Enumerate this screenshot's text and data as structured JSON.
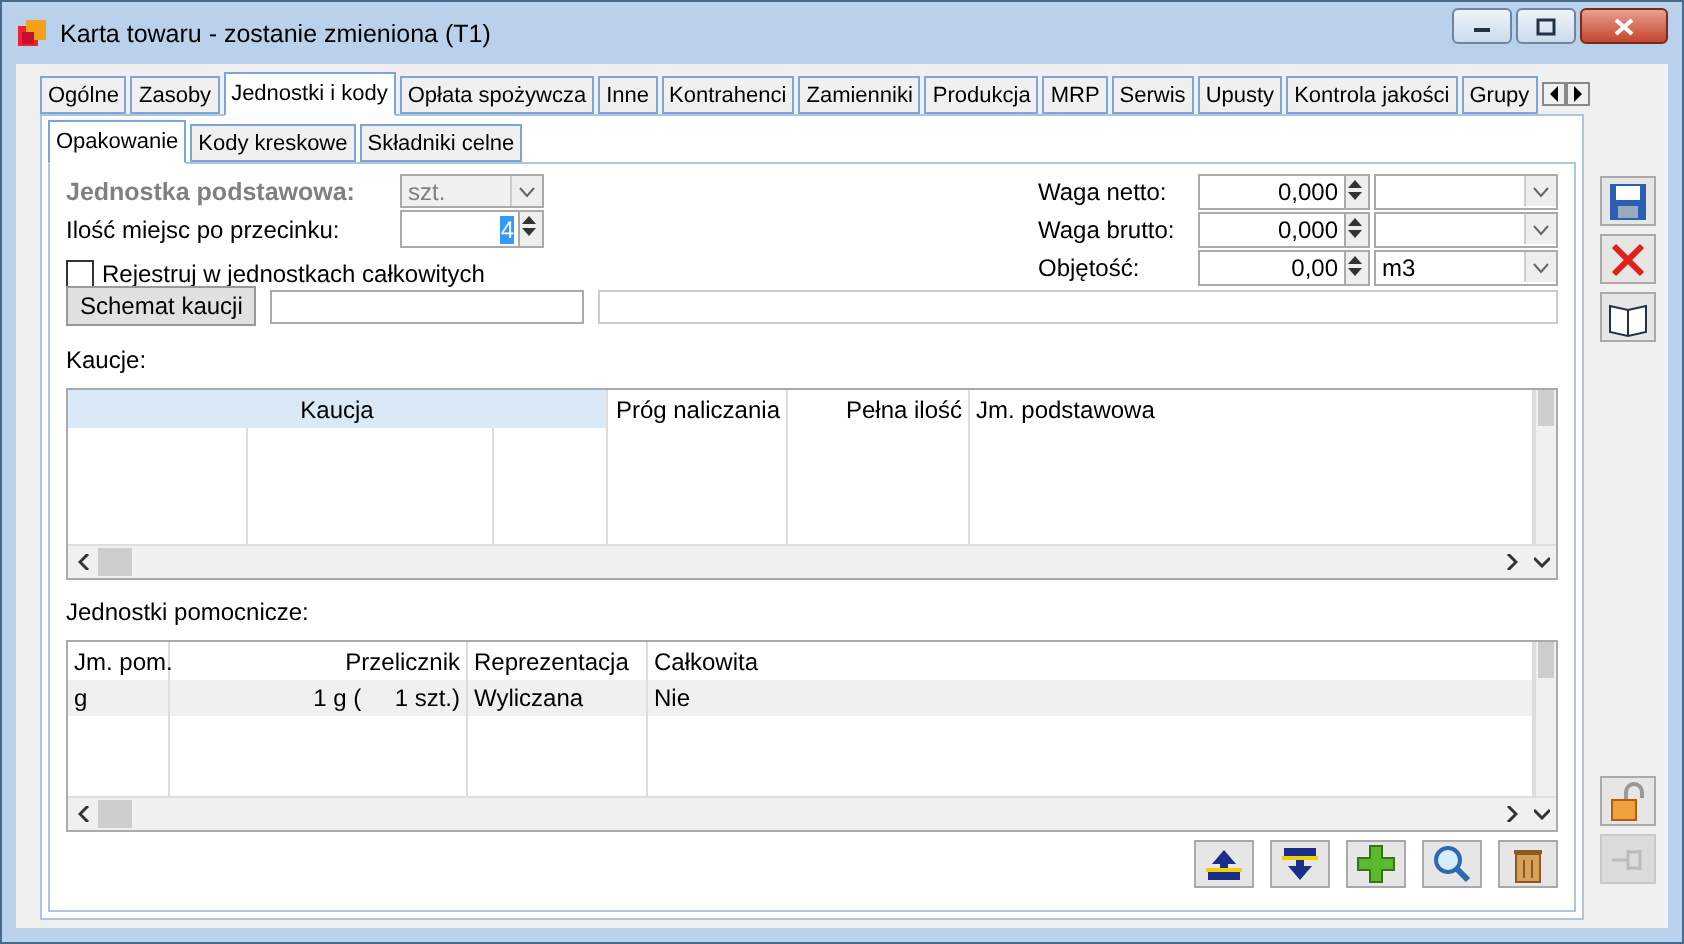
{
  "window": {
    "title": "Karta towaru - zostanie zmieniona (T1)"
  },
  "tabs": [
    {
      "label": "Ogólne",
      "selected": false
    },
    {
      "label": "Zasoby",
      "selected": false
    },
    {
      "label": "Jednostki i kody",
      "selected": true
    },
    {
      "label": "Opłata spożywcza",
      "selected": false
    },
    {
      "label": "Inne",
      "selected": false
    },
    {
      "label": "Kontrahenci",
      "selected": false
    },
    {
      "label": "Zamienniki",
      "selected": false
    },
    {
      "label": "Produkcja",
      "selected": false
    },
    {
      "label": "MRP",
      "selected": false
    },
    {
      "label": "Serwis",
      "selected": false
    },
    {
      "label": "Upusty",
      "selected": false
    },
    {
      "label": "Kontrola jakości",
      "selected": false
    },
    {
      "label": "Grupy",
      "selected": false
    }
  ],
  "subtabs": [
    {
      "label": "Opakowanie",
      "selected": true
    },
    {
      "label": "Kody kreskowe",
      "selected": false
    },
    {
      "label": "Składniki celne",
      "selected": false
    }
  ],
  "base_unit": {
    "label": "Jednostka podstawowa:",
    "value": "szt.",
    "disabled": true
  },
  "decimal_places": {
    "label": "Ilość miejsc po przecinku:",
    "value": "4"
  },
  "integer_units": {
    "label": "Rejestruj w jednostkach całkowitych",
    "checked": false
  },
  "deposit_scheme": {
    "button": "Schemat kaucji"
  },
  "measures": [
    {
      "label": "Waga netto:",
      "value": "0,000"
    },
    {
      "label": "Waga brutto:",
      "value": "0,000"
    },
    {
      "label": "Objętość:",
      "value": "0,00",
      "unit": "m3"
    }
  ],
  "deposits": {
    "label": "Kaucje:",
    "columns": [
      {
        "title": "Kaucja",
        "selected": true
      },
      {
        "title": "Próg naliczania",
        "selected": false
      },
      {
        "title": "Pełna ilość",
        "selected": false
      },
      {
        "title": "Jm. podstawowa",
        "selected": false
      }
    ]
  },
  "aux_units": {
    "label": "Jednostki pomocnicze:",
    "columns": [
      "Jm. pom.",
      "Przelicznik",
      "Reprezentacja",
      "Całkowita"
    ],
    "rows": [
      {
        "cells": [
          "g",
          "1 g (     1 szt.)",
          "Wyliczana",
          "Nie"
        ],
        "selected": true
      }
    ]
  },
  "grid_buttons": [
    {
      "kind": "up"
    },
    {
      "kind": "down"
    },
    {
      "kind": "add"
    },
    {
      "kind": "search"
    },
    {
      "kind": "delete"
    }
  ],
  "side_toolbar": [
    {
      "kind": "save",
      "disabled": false
    },
    {
      "kind": "cancel",
      "disabled": false
    },
    {
      "kind": "book",
      "disabled": false
    },
    {
      "kind": "lock",
      "disabled": false
    },
    {
      "kind": "pin",
      "disabled": true
    }
  ]
}
